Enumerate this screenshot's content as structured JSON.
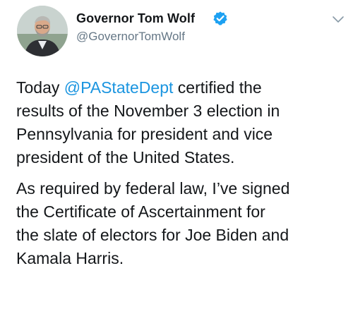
{
  "author": {
    "display_name": "Governor Tom Wolf",
    "handle": "@GovernorTomWolf",
    "verified": true,
    "avatar_icon": "profile-photo"
  },
  "menu_icon": "chevron-down-icon",
  "tweet": {
    "paragraph1": {
      "line1_before": "Today ",
      "mention": "@PAStateDept",
      "line1_after": " certified the",
      "line2": "results of the November 3 election in",
      "line3": "Pennsylvania for president and vice",
      "line4": "president of the United States."
    },
    "paragraph2": {
      "line1": "As required by federal law, I’ve signed",
      "line2": "the Certificate of Ascertainment for",
      "line3": "the slate of electors for Joe Biden and",
      "line4": "Kamala Harris."
    }
  },
  "colors": {
    "link": "#1b95e0",
    "verified_badge": "#1da1f2",
    "secondary_text": "#657786",
    "primary_text": "#14171a"
  }
}
